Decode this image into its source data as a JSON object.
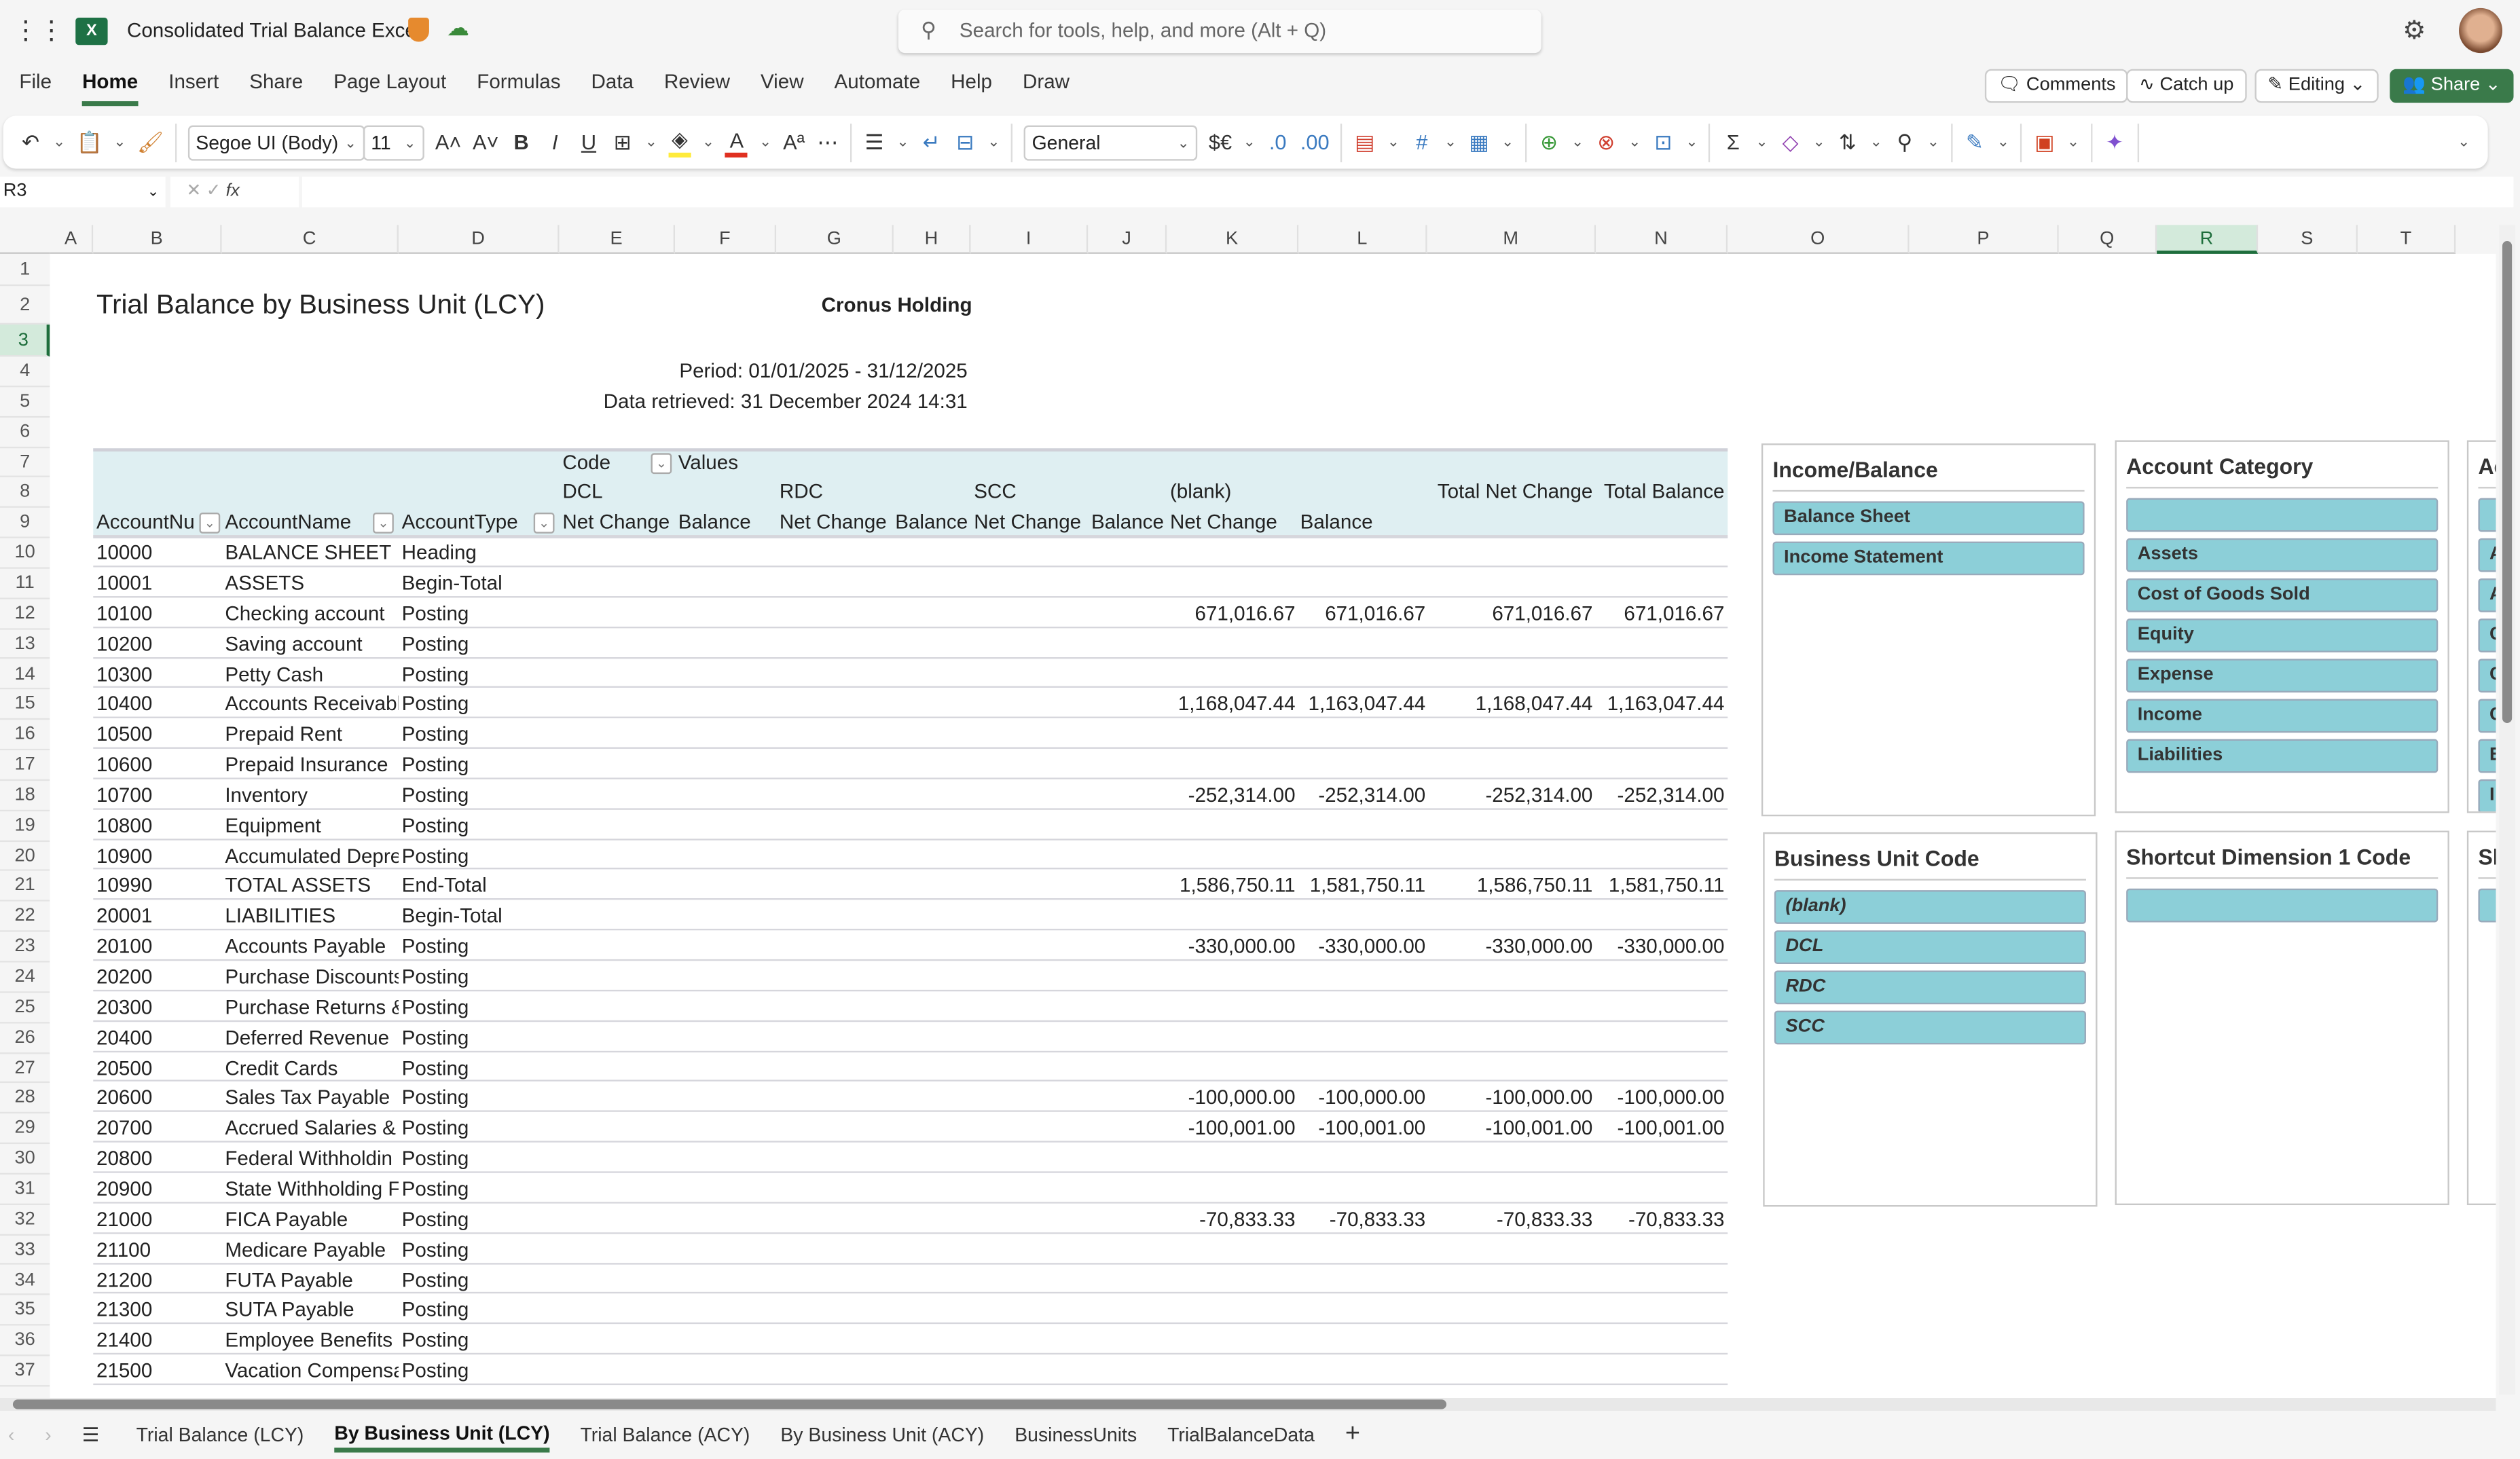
{
  "app": {
    "title": "Consolidated Trial Balance Excel",
    "search_placeholder": "Search for tools, help, and more (Alt + Q)",
    "brand_color": "#1e6e3c"
  },
  "menu": [
    "File",
    "Home",
    "Insert",
    "Share",
    "Page Layout",
    "Formulas",
    "Data",
    "Review",
    "View",
    "Automate",
    "Help",
    "Draw"
  ],
  "menu_active": "Home",
  "actions": {
    "comments": "Comments",
    "catch_up": "Catch up",
    "editing": "Editing",
    "share": "Share"
  },
  "ribbon": {
    "font": "Segoe UI (Body)",
    "size": "11",
    "number_format": "General"
  },
  "formula_bar": {
    "name_box": "R3",
    "formula": ""
  },
  "columns": [
    "A",
    "B",
    "C",
    "D",
    "E",
    "F",
    "G",
    "H",
    "I",
    "J",
    "K",
    "L",
    "M",
    "N",
    "O",
    "P",
    "Q",
    "R",
    "S",
    "T"
  ],
  "selected_column": "R",
  "selected_row": 3,
  "report": {
    "title": "Trial Balance by Business Unit (LCY)",
    "company": "Cronus Holding",
    "period": "Period: 01/01/2025 - 31/12/2025",
    "retrieved": "Data retrieved: 31 December 2024 14:31"
  },
  "pivot": {
    "code_label": "Code",
    "values_label": "Values",
    "units": [
      "DCL",
      "RDC",
      "SCC",
      "(blank)"
    ],
    "total_net_change": "Total Net Change",
    "total_balance": "Total Balance",
    "row_headers": [
      "AccountNu",
      "AccountName",
      "AccountType"
    ],
    "net_change": "Net Change",
    "balance": "Balance",
    "rows": [
      [
        "10000",
        "BALANCE SHEET",
        "Heading",
        "",
        "",
        "",
        ""
      ],
      [
        "10001",
        "ASSETS",
        "Begin-Total",
        "",
        "",
        "",
        ""
      ],
      [
        "10100",
        "Checking account",
        "Posting",
        "671,016.67",
        "671,016.67",
        "671,016.67",
        "671,016.67"
      ],
      [
        "10200",
        "Saving account",
        "Posting",
        "",
        "",
        "",
        ""
      ],
      [
        "10300",
        "Petty Cash",
        "Posting",
        "",
        "",
        "",
        ""
      ],
      [
        "10400",
        "Accounts Receivabl",
        "Posting",
        "1,168,047.44",
        "1,163,047.44",
        "1,168,047.44",
        "1,163,047.44"
      ],
      [
        "10500",
        "Prepaid Rent",
        "Posting",
        "",
        "",
        "",
        ""
      ],
      [
        "10600",
        "Prepaid Insurance",
        "Posting",
        "",
        "",
        "",
        ""
      ],
      [
        "10700",
        "Inventory",
        "Posting",
        "-252,314.00",
        "-252,314.00",
        "-252,314.00",
        "-252,314.00"
      ],
      [
        "10800",
        "Equipment",
        "Posting",
        "",
        "",
        "",
        ""
      ],
      [
        "10900",
        "Accumulated Depre",
        "Posting",
        "",
        "",
        "",
        ""
      ],
      [
        "10990",
        "TOTAL ASSETS",
        "End-Total",
        "1,586,750.11",
        "1,581,750.11",
        "1,586,750.11",
        "1,581,750.11"
      ],
      [
        "20001",
        "LIABILITIES",
        "Begin-Total",
        "",
        "",
        "",
        ""
      ],
      [
        "20100",
        "Accounts Payable",
        "Posting",
        "-330,000.00",
        "-330,000.00",
        "-330,000.00",
        "-330,000.00"
      ],
      [
        "20200",
        "Purchase Discounts",
        "Posting",
        "",
        "",
        "",
        ""
      ],
      [
        "20300",
        "Purchase Returns &",
        "Posting",
        "",
        "",
        "",
        ""
      ],
      [
        "20400",
        "Deferred Revenue",
        "Posting",
        "",
        "",
        "",
        ""
      ],
      [
        "20500",
        "Credit Cards",
        "Posting",
        "",
        "",
        "",
        ""
      ],
      [
        "20600",
        "Sales Tax Payable",
        "Posting",
        "-100,000.00",
        "-100,000.00",
        "-100,000.00",
        "-100,000.00"
      ],
      [
        "20700",
        "Accrued Salaries &",
        "Posting",
        "-100,001.00",
        "-100,001.00",
        "-100,001.00",
        "-100,001.00"
      ],
      [
        "20800",
        "Federal Withholdin",
        "Posting",
        "",
        "",
        "",
        ""
      ],
      [
        "20900",
        "State Withholding F",
        "Posting",
        "",
        "",
        "",
        ""
      ],
      [
        "21000",
        "FICA Payable",
        "Posting",
        "-70,833.33",
        "-70,833.33",
        "-70,833.33",
        "-70,833.33"
      ],
      [
        "21100",
        "Medicare Payable",
        "Posting",
        "",
        "",
        "",
        ""
      ],
      [
        "21200",
        "FUTA Payable",
        "Posting",
        "",
        "",
        "",
        ""
      ],
      [
        "21300",
        "SUTA Payable",
        "Posting",
        "",
        "",
        "",
        ""
      ],
      [
        "21400",
        "Employee Benefits I",
        "Posting",
        "",
        "",
        "",
        ""
      ],
      [
        "21500",
        "Vacation Compensa",
        "Posting",
        "",
        "",
        "",
        ""
      ]
    ]
  },
  "slicers": [
    {
      "title": "Income/Balance",
      "items": [
        "Balance Sheet",
        "Income Statement"
      ],
      "italic": false
    },
    {
      "title": "Account Category",
      "items": [
        "",
        "Assets",
        "Cost of Goods Sold",
        "Equity",
        "Expense",
        "Income",
        "Liabilities"
      ],
      "italic": false
    },
    {
      "title": "Ac",
      "items": [
        "",
        "A",
        "A",
        "C",
        "C",
        "C",
        "E",
        "I"
      ],
      "italic": false
    },
    {
      "title": "Business Unit Code",
      "items": [
        "(blank)",
        "DCL",
        "RDC",
        "SCC"
      ],
      "italic": true
    },
    {
      "title": "Shortcut Dimension 1 Code",
      "items": [
        ""
      ],
      "italic": false
    },
    {
      "title": "Sh",
      "items": [
        ""
      ],
      "italic": false
    }
  ],
  "slicer_color": "#8ccfd8",
  "sheet_tabs": [
    "Trial Balance (LCY)",
    "By Business Unit (LCY)",
    "Trial Balance (ACY)",
    "By Business Unit (ACY)",
    "BusinessUnits",
    "TrialBalanceData"
  ],
  "active_sheet": "By Business Unit (LCY)"
}
